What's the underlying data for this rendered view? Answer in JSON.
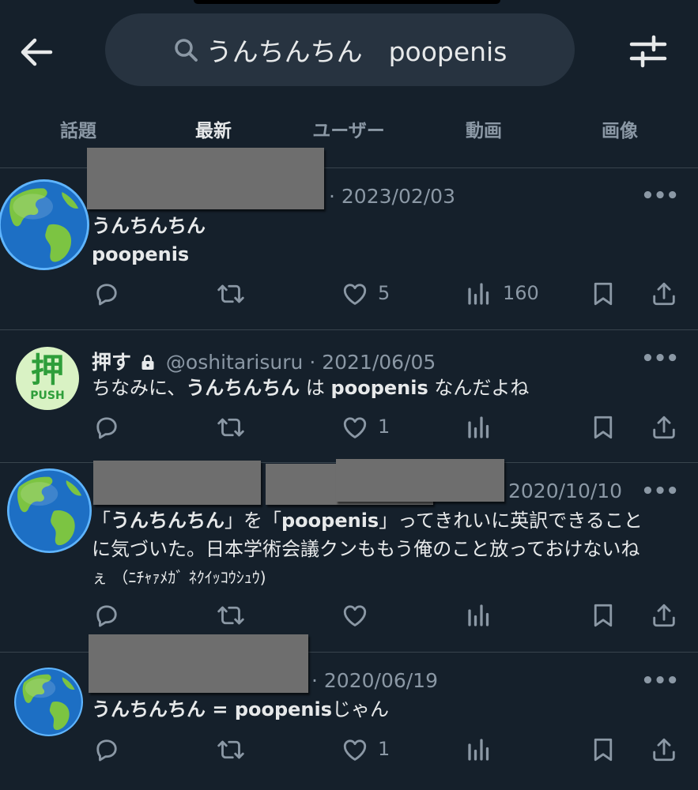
{
  "search": {
    "query": "うんちんちん　poopenis"
  },
  "tabs": [
    {
      "label": "話題"
    },
    {
      "label": "最新"
    },
    {
      "label": "ユーザー"
    },
    {
      "label": "動画"
    },
    {
      "label": "画像"
    }
  ],
  "active_tab": "最新",
  "tweets": [
    {
      "date": "· 2023/02/03",
      "lines": [
        "うんちんちん",
        "poopenis"
      ],
      "replies": "",
      "retweets": "",
      "likes": "5",
      "views": "160"
    },
    {
      "name": "押す",
      "handle": "@oshitarisuru",
      "date": "· 2021/06/05",
      "text_parts": [
        "ちなみに、",
        "うんちんちん",
        " は ",
        "poopenis",
        " なんだよね"
      ],
      "likes": "1",
      "avatar_char": "押",
      "avatar_sub": "PUSH"
    },
    {
      "date": "2020/10/10",
      "line1_parts": [
        "「",
        "うんちんちん",
        "」を「",
        "poopenis",
        "」ってきれいに英訳できること"
      ],
      "line2": "に気づいた。日本学術会議クンももう俺のこと放っておけないね",
      "line3": "ぇ （ﾆﾁｬｧﾒｶﾞ ﾈｸｲｯｺｳｼｭｳ)"
    },
    {
      "date": "· 2020/06/19",
      "text_parts": [
        "うんちんちん = poopenis",
        "じゃん"
      ],
      "likes": "1"
    }
  ],
  "more_glyph": "•••",
  "colors": {
    "background": "#15202b",
    "search_bg": "#273340",
    "text_primary": "#e7e9ea",
    "text_secondary": "#8b98a5",
    "divider": "#38444d",
    "redaction": "#6e6e6e",
    "push_avatar_bg": "#d9f2c4",
    "push_avatar_fg": "#2e9e3a"
  },
  "icons": [
    "back-arrow-icon",
    "search-icon",
    "filter-sliders-icon",
    "globe-icon",
    "lock-icon",
    "more-icon",
    "reply-icon",
    "retweet-icon",
    "like-icon",
    "views-icon",
    "bookmark-icon",
    "share-icon"
  ]
}
